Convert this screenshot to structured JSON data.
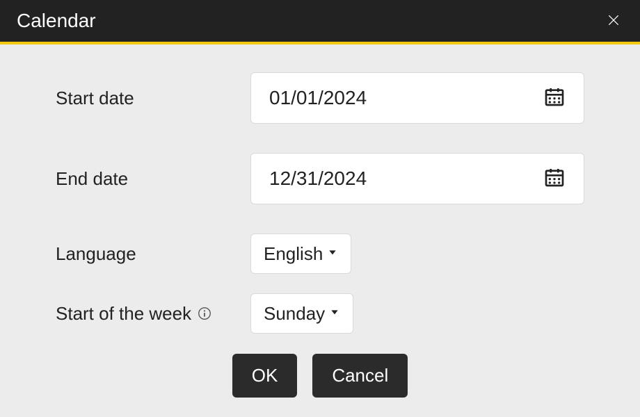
{
  "titlebar": {
    "title": "Calendar"
  },
  "form": {
    "start_date_label": "Start date",
    "start_date_value": "01/01/2024",
    "end_date_label": "End date",
    "end_date_value": "12/31/2024",
    "language_label": "Language",
    "language_value": "English",
    "start_week_label": "Start of the week",
    "start_week_value": "Sunday"
  },
  "footer": {
    "ok_label": "OK",
    "cancel_label": "Cancel"
  }
}
